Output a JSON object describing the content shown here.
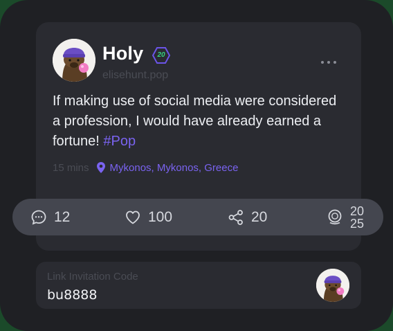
{
  "post": {
    "author_name": "Holy",
    "level": "20",
    "handle": "elisehunt.pop",
    "text_main": "If making use of social media were considered a profession, I would have already earned a fortune!",
    "hashtag": "#Pop",
    "time": "15 mins",
    "location": "Mykonos, Mykonos, Greece"
  },
  "actions": {
    "comments": "12",
    "likes": "100",
    "shares": "20",
    "coin_top": "20",
    "coin_bottom": "25"
  },
  "invite": {
    "label": "Link Invitation Code",
    "code": "bu8888"
  },
  "colors": {
    "accent": "#7a63f0",
    "level_green": "#35d07f",
    "card_bg": "#2a2b31",
    "action_bar_bg": "#44464f"
  }
}
